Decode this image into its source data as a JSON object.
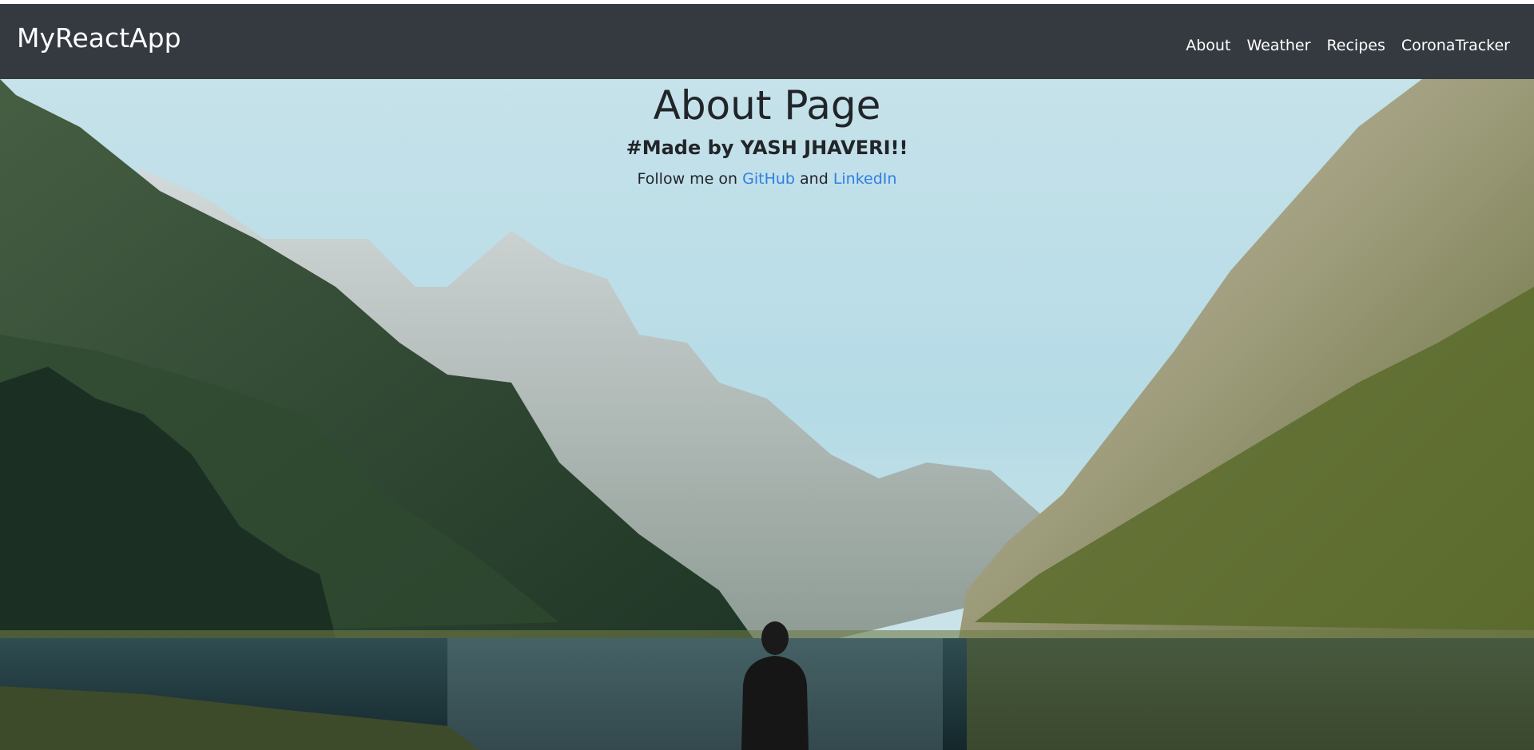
{
  "navbar": {
    "brand": "MyReactApp",
    "links": [
      "About",
      "Weather",
      "Recipes",
      "CoronaTracker"
    ]
  },
  "hero": {
    "title": "About Page",
    "subtitle": "#Made by YASH JHAVERI!!",
    "follow_prefix": "Follow me on",
    "github_label": "GitHub",
    "and_text": "and",
    "linkedin_label": "LinkedIn"
  },
  "colors": {
    "navbar_bg": "#343a40",
    "link": "#2f7fe0",
    "text": "#212529"
  }
}
